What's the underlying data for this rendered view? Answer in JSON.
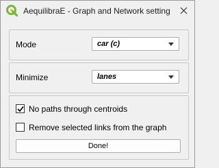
{
  "window": {
    "title": "AequilibraE - Graph and Network setting",
    "app_icon": "qgis-logo-icon",
    "close_icon": "close-icon"
  },
  "mode": {
    "label": "Mode",
    "selected": "car (c)"
  },
  "minimize": {
    "label": "Minimize",
    "selected": "lanes"
  },
  "options": {
    "no_paths_label": "No paths through centroids",
    "no_paths_checked": true,
    "remove_links_label": "Remove selected links from the graph",
    "remove_links_checked": false
  },
  "done_button": {
    "label": "Done!"
  },
  "colors": {
    "background": "#f0f0f0",
    "logo_green": "#7cb342"
  }
}
